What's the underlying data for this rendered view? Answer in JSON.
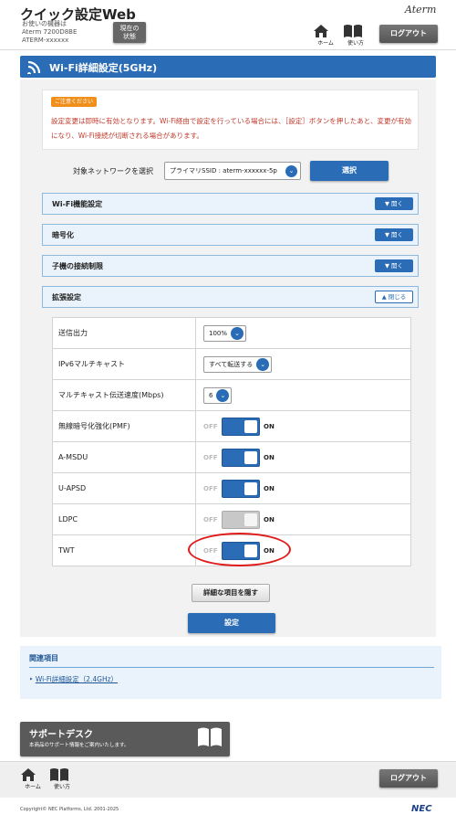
{
  "header": {
    "app_title": "クイック設定Web",
    "device_label": "お使いの機器は",
    "device_model": "Aterm 7200D8BE",
    "device_name": "ATERM-xxxxxx",
    "status_button_line1": "現在の",
    "status_button_line2": "状態",
    "brand": "Aterm",
    "home_label": "ホーム",
    "howto_label": "使い方",
    "logout_label": "ログアウト"
  },
  "page": {
    "title": "Wi-Fi詳細設定(5GHz)"
  },
  "notice": {
    "badge": "ご注意ください",
    "text": "設定変更は即時に有効となります。Wi-Fi経由で設定を行っている場合には、［設定］ボタンを押したあと、変更が有効になり、Wi-Fi接続が切断される場合があります。"
  },
  "network_select": {
    "label": "対象ネットワークを選択",
    "value": "プライマリSSID : aterm-xxxxxx-5p",
    "button": "選択"
  },
  "sections": [
    {
      "label": "Wi-Fi機能設定",
      "button": "開く"
    },
    {
      "label": "暗号化",
      "button": "開く"
    },
    {
      "label": "子機の接続制限",
      "button": "開く"
    },
    {
      "label": "拡張設定",
      "button": "閉じる"
    }
  ],
  "settings": {
    "tx_power": {
      "label": "送信出力",
      "value": "100%"
    },
    "ipv6_multicast": {
      "label": "IPv6マルチキャスト",
      "value": "すべて転送する"
    },
    "multicast_rate": {
      "label": "マルチキャスト伝送速度(Mbps)",
      "value": "6"
    },
    "pmf": {
      "label": "無線暗号化強化(PMF)",
      "state": "on"
    },
    "amsdu": {
      "label": "A-MSDU",
      "state": "on"
    },
    "uapsd": {
      "label": "U-APSD",
      "state": "on"
    },
    "ldpc": {
      "label": "LDPC",
      "state": "off"
    },
    "twt": {
      "label": "TWT",
      "state": "on"
    },
    "off_label": "OFF",
    "on_label": "ON"
  },
  "actions": {
    "hide_details": "詳細な項目を隠す",
    "apply": "設定"
  },
  "related": {
    "title": "関連項目",
    "link": "Wi-Fi詳細設定（2.4GHz）"
  },
  "support": {
    "title": "サポートデスク",
    "subtitle": "本商品のサポート情報をご案内いたします。"
  },
  "footer": {
    "home_label": "ホーム",
    "howto_label": "使い方",
    "logout_label": "ログアウト",
    "copyright": "Copyright© NEC Platforms, Ltd. 2001-2025",
    "nec_logo": "NEC"
  },
  "colors": {
    "primary": "#2a6cb5",
    "notice_text": "#c0392b",
    "notice_badge": "#f08f1c",
    "highlight": "#e01b1b"
  },
  "icons": {
    "home": "home-icon",
    "howto": "book-icon",
    "wifi": "wifi-icon",
    "chevron": "chevron-down-icon"
  }
}
